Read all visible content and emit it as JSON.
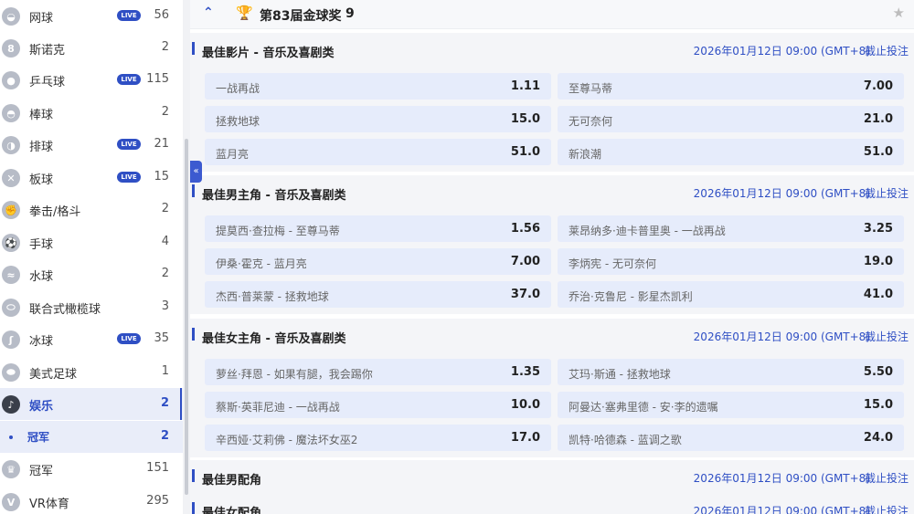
{
  "sidebar": {
    "items": [
      {
        "label": "网球",
        "live": true,
        "count": "56",
        "icon": "tennis-icon"
      },
      {
        "label": "斯诺克",
        "live": false,
        "count": "2",
        "icon": "snooker-icon"
      },
      {
        "label": "乒乓球",
        "live": true,
        "count": "115",
        "icon": "table-tennis-icon"
      },
      {
        "label": "棒球",
        "live": false,
        "count": "2",
        "icon": "baseball-icon"
      },
      {
        "label": "排球",
        "live": true,
        "count": "21",
        "icon": "volleyball-icon"
      },
      {
        "label": "板球",
        "live": true,
        "count": "15",
        "icon": "cricket-icon"
      },
      {
        "label": "拳击/格斗",
        "live": false,
        "count": "2",
        "icon": "boxing-icon"
      },
      {
        "label": "手球",
        "live": false,
        "count": "4",
        "icon": "handball-icon"
      },
      {
        "label": "水球",
        "live": false,
        "count": "2",
        "icon": "water-polo-icon"
      },
      {
        "label": "联合式橄榄球",
        "live": false,
        "count": "3",
        "icon": "rugby-icon"
      },
      {
        "label": "冰球",
        "live": true,
        "count": "35",
        "icon": "ice-hockey-icon"
      },
      {
        "label": "美式足球",
        "live": false,
        "count": "1",
        "icon": "american-football-icon"
      },
      {
        "label": "娱乐",
        "live": false,
        "count": "2",
        "icon": "microphone-icon",
        "active": true
      },
      {
        "label": "冠军",
        "live": false,
        "count": "2",
        "sub": true
      },
      {
        "label": "冠军",
        "live": false,
        "count": "151",
        "icon": "trophy-icon"
      },
      {
        "label": "VR体育",
        "live": false,
        "count": "295",
        "icon": "vr-icon"
      }
    ],
    "live_label": "LIVE",
    "collapse_glyph": "«"
  },
  "event": {
    "title": "第83届金球奖",
    "count": "9"
  },
  "markets": [
    {
      "title": "最佳影片 - 音乐及喜剧类",
      "time": "2026年01月12日 09:00 (GMT+8)",
      "cutoff": "截止投注",
      "selections": [
        {
          "name": "一战再战",
          "price": "1.11"
        },
        {
          "name": "至尊马蒂",
          "price": "7.00"
        },
        {
          "name": "拯救地球",
          "price": "15.0"
        },
        {
          "name": "无可奈何",
          "price": "21.0"
        },
        {
          "name": "蓝月亮",
          "price": "51.0"
        },
        {
          "name": "新浪潮",
          "price": "51.0"
        }
      ]
    },
    {
      "title": "最佳男主角 - 音乐及喜剧类",
      "time": "2026年01月12日 09:00 (GMT+8)",
      "cutoff": "截止投注",
      "selections": [
        {
          "name": "提莫西·查拉梅 - 至尊马蒂",
          "price": "1.56"
        },
        {
          "name": "莱昂纳多·迪卡普里奥 - 一战再战",
          "price": "3.25"
        },
        {
          "name": "伊桑·霍克 - 蓝月亮",
          "price": "7.00"
        },
        {
          "name": "李炳宪 - 无可奈何",
          "price": "19.0"
        },
        {
          "name": "杰西·普莱蒙 - 拯救地球",
          "price": "37.0"
        },
        {
          "name": "乔治·克鲁尼 - 影星杰凯利",
          "price": "41.0"
        }
      ]
    },
    {
      "title": "最佳女主角 - 音乐及喜剧类",
      "time": "2026年01月12日 09:00 (GMT+8)",
      "cutoff": "截止投注",
      "selections": [
        {
          "name": "萝丝·拜恩 - 如果有腿，我会踢你",
          "price": "1.35"
        },
        {
          "name": "艾玛·斯通 - 拯救地球",
          "price": "5.50"
        },
        {
          "name": "蔡斯·英菲尼迪 - 一战再战",
          "price": "10.0"
        },
        {
          "name": "阿曼达·塞弗里德 - 安·李的遗嘱",
          "price": "15.0"
        },
        {
          "name": "辛西娅·艾莉佛 - 魔法坏女巫2",
          "price": "17.0"
        },
        {
          "name": "凯特·哈德森 - 蓝调之歌",
          "price": "24.0"
        }
      ]
    },
    {
      "title": "最佳男配角",
      "time": "2026年01月12日 09:00 (GMT+8)",
      "cutoff": "截止投注",
      "selections": []
    },
    {
      "title": "最佳女配角",
      "time": "2026年01月12日 09:00 (GMT+8)",
      "cutoff": "截止投注",
      "selections": []
    }
  ],
  "colors": {
    "accent": "#2f4fc4",
    "odd_bg": "#e6ecfb",
    "trophy": "#c9932b"
  }
}
